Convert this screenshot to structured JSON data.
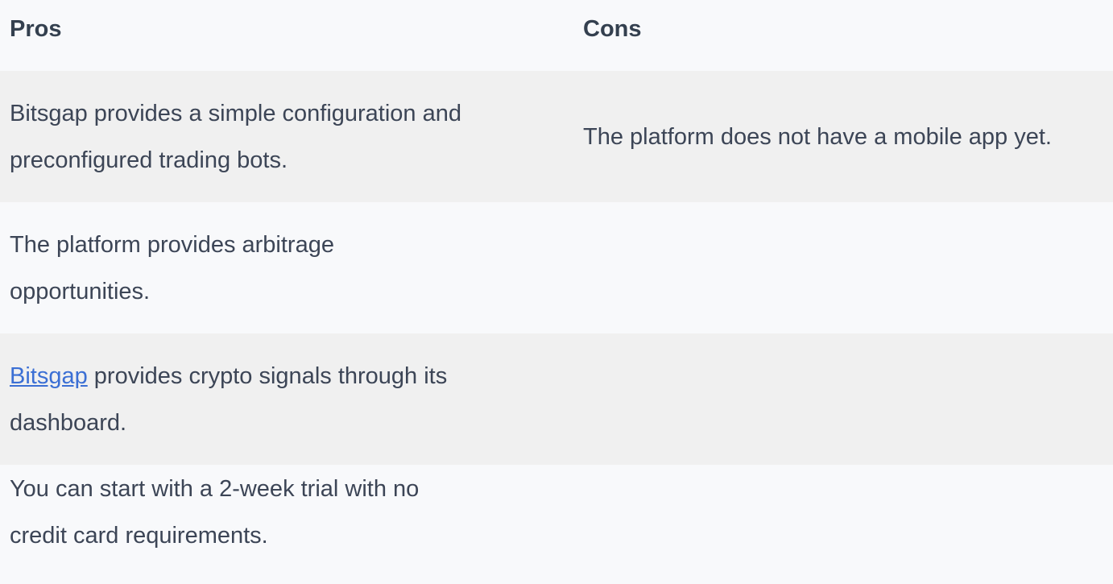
{
  "table": {
    "headers": {
      "pros": "Pros",
      "cons": "Cons"
    },
    "rows": [
      {
        "pros": "Bitsgap provides a simple configuration and preconfigured trading bots.",
        "cons": "The platform does not have a mobile app yet."
      },
      {
        "pros": "The platform provides arbitrage opportunities.",
        "cons": ""
      },
      {
        "pros_link": "Bitsgap",
        "pros_rest": " provides crypto signals through its dashboard.",
        "cons": ""
      },
      {
        "pros": "You can start with a 2-week trial with no credit card requirements.",
        "cons": ""
      }
    ]
  },
  "colors": {
    "text": "#3c4556",
    "link": "#3b6fd4",
    "row_shade": "#f0f0f0",
    "row_plain": "#f8f9fb"
  }
}
